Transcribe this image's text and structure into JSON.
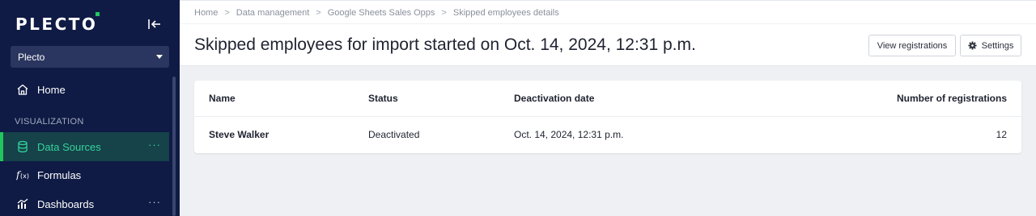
{
  "sidebar": {
    "logo_text": "PLECTO",
    "org_selector": {
      "value": "Plecto"
    },
    "section_label": "VISUALIZATION",
    "items": [
      {
        "label": "Home",
        "icon": "home-icon"
      },
      {
        "label": "Data Sources",
        "icon": "database-icon",
        "active": true,
        "more": "···"
      },
      {
        "label": "Formulas",
        "icon": "formula-icon"
      },
      {
        "label": "Dashboards",
        "icon": "dashboard-chart-icon",
        "more": "···"
      }
    ],
    "accent_color": "#22c55e"
  },
  "breadcrumb": [
    "Home",
    "Data management",
    "Google Sheets Sales Opps",
    "Skipped employees details"
  ],
  "page": {
    "title": "Skipped employees for import started on Oct. 14, 2024, 12:31 p.m."
  },
  "actions": {
    "view_registrations": "View registrations",
    "settings": "Settings"
  },
  "table": {
    "columns": [
      "Name",
      "Status",
      "Deactivation date",
      "Number of registrations"
    ],
    "rows": [
      {
        "name": "Steve Walker",
        "status": "Deactivated",
        "deactivation_date": "Oct. 14, 2024, 12:31 p.m.",
        "registrations": "12"
      }
    ]
  }
}
